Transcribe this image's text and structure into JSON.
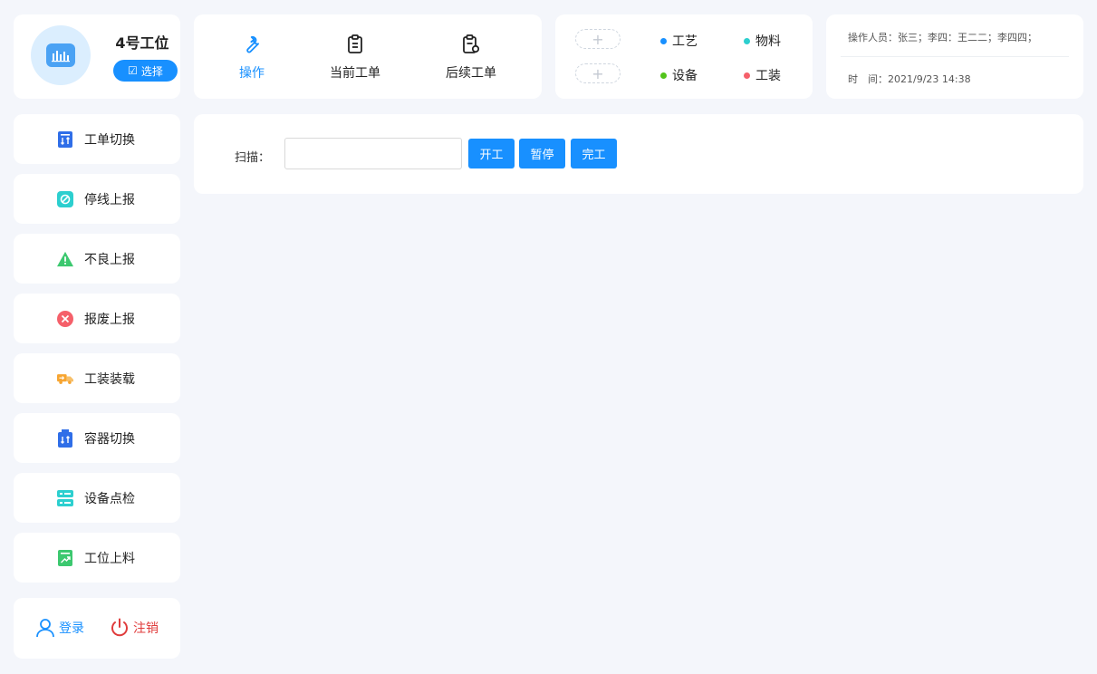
{
  "station": {
    "title": "4号工位",
    "select_label": "选择"
  },
  "tabs": [
    {
      "label": "操作",
      "icon": "wrench-icon",
      "active": true
    },
    {
      "label": "当前工单",
      "icon": "clipboard-icon",
      "active": false
    },
    {
      "label": "后续工单",
      "icon": "clipboard-settings-icon",
      "active": false
    }
  ],
  "legend": {
    "plus": "+",
    "items": [
      {
        "label": "工艺",
        "color": "#1890ff"
      },
      {
        "label": "物料",
        "color": "#2ccfcf"
      },
      {
        "label": "设备",
        "color": "#52c41a"
      },
      {
        "label": "工装",
        "color": "#f5606a"
      }
    ]
  },
  "info": {
    "operators": "操作人员：张三；李四：王二二；李四四；",
    "time_label": "时　间：",
    "time_value": "2021/9/23 14:38"
  },
  "sidebar": {
    "items": [
      {
        "label": "工单切换",
        "icon": "order-switch-icon",
        "color": "#2f6ee8"
      },
      {
        "label": "停线上报",
        "icon": "stop-line-icon",
        "color": "#2ccfcf"
      },
      {
        "label": "不良上报",
        "icon": "warning-icon",
        "color": "#3cc86f"
      },
      {
        "label": "报废上报",
        "icon": "scrap-icon",
        "color": "#f5606a"
      },
      {
        "label": "工装装载",
        "icon": "truck-icon",
        "color": "#f7a531"
      },
      {
        "label": "容器切换",
        "icon": "container-switch-icon",
        "color": "#2f6ee8"
      },
      {
        "label": "设备点检",
        "icon": "server-icon",
        "color": "#2ccfcf"
      },
      {
        "label": "工位上料",
        "icon": "chart-up-icon",
        "color": "#3cc86f"
      }
    ]
  },
  "auth": {
    "login_label": "登录",
    "logout_label": "注销"
  },
  "main": {
    "scan_label": "扫描：",
    "scan_value": "",
    "start_label": "开工",
    "pause_label": "暂停",
    "finish_label": "完工"
  },
  "colors": {
    "primary": "#1890ff",
    "danger": "#e03c3c"
  }
}
